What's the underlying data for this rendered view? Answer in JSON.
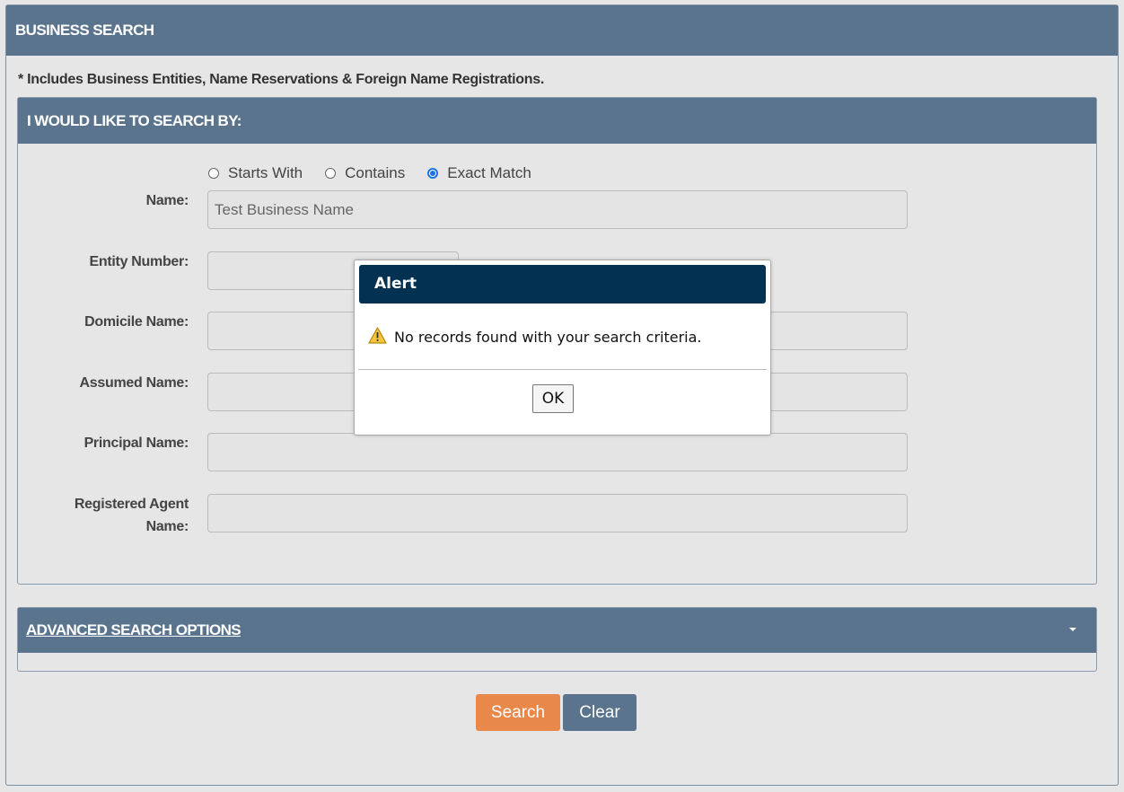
{
  "page": {
    "title": "BUSINESS SEARCH",
    "note": "* Includes Business Entities, Name Reservations & Foreign Name Registrations."
  },
  "search_by": {
    "header": "I WOULD LIKE TO SEARCH BY:",
    "radio_options": [
      {
        "label": "Starts With",
        "checked": false
      },
      {
        "label": "Contains",
        "checked": false
      },
      {
        "label": "Exact Match",
        "checked": true
      }
    ],
    "fields": {
      "name": {
        "label": "Name:",
        "value": "Test Business Name"
      },
      "entity_number": {
        "label": "Entity Number:",
        "value": ""
      },
      "domicile_name": {
        "label": "Domicile Name:",
        "value": ""
      },
      "assumed_name": {
        "label": "Assumed Name:",
        "value": ""
      },
      "principal_name": {
        "label": "Principal Name:",
        "value": ""
      },
      "registered_agent": {
        "label_line1": "Registered Agent",
        "label_line2": "Name:",
        "value": ""
      }
    }
  },
  "advanced": {
    "label": "ADVANCED SEARCH OPTIONS",
    "icon": "caret-down-icon"
  },
  "buttons": {
    "search": "Search",
    "clear": "Clear"
  },
  "alert": {
    "title": "Alert",
    "message": "No records found with your search criteria.",
    "icon": "warning-icon",
    "ok": "OK"
  },
  "colors": {
    "header_bg": "#5a748d",
    "search_button": "#e8884a",
    "clear_button": "#5a748d",
    "alert_title_bg": "#033152",
    "radio_accent": "#1a73e8"
  }
}
